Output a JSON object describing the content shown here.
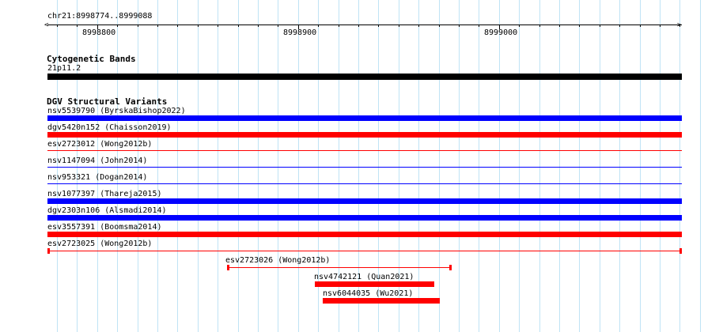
{
  "ruler": {
    "range_label": "chr21:8998774..8999088",
    "tick_labels": [
      "8998800",
      "8998900",
      "8999000"
    ]
  },
  "cytoband_track": {
    "title": "Cytogenetic Bands",
    "band_label": "21p11.2",
    "band_color": "#000000"
  },
  "dgv_track": {
    "title": "DGV Structural Variants",
    "colors": {
      "blue": "#0000ff",
      "red": "#ff0000"
    },
    "features": [
      {
        "label": "nsv5539790 (ByrskaBishop2022)",
        "color": "blue",
        "style": "thick"
      },
      {
        "label": "dgv5420n152 (Chaisson2019)",
        "color": "red",
        "style": "thick"
      },
      {
        "label": "esv2723012 (Wong2012b)",
        "color": "red",
        "style": "thin"
      },
      {
        "label": "nsv1147094 (John2014)",
        "color": "blue",
        "style": "thin"
      },
      {
        "label": "nsv953321 (Dogan2014)",
        "color": "blue",
        "style": "thin"
      },
      {
        "label": "nsv1077397 (Thareja2015)",
        "color": "blue",
        "style": "thick"
      },
      {
        "label": "dgv2303n106 (Alsmadi2014)",
        "color": "blue",
        "style": "thick"
      },
      {
        "label": "esv3557391 (Boomsma2014)",
        "color": "red",
        "style": "thick"
      },
      {
        "label": "esv2723025 (Wong2012b)",
        "color": "red",
        "style": "capped"
      },
      {
        "label": "esv2723026 (Wong2012b)",
        "color": "red",
        "style": "capped"
      },
      {
        "label": "nsv4742121 (Quan2021)",
        "color": "red",
        "style": "thick"
      },
      {
        "label": "nsv6044035 (Wu2021)",
        "color": "red",
        "style": "thick"
      }
    ]
  }
}
